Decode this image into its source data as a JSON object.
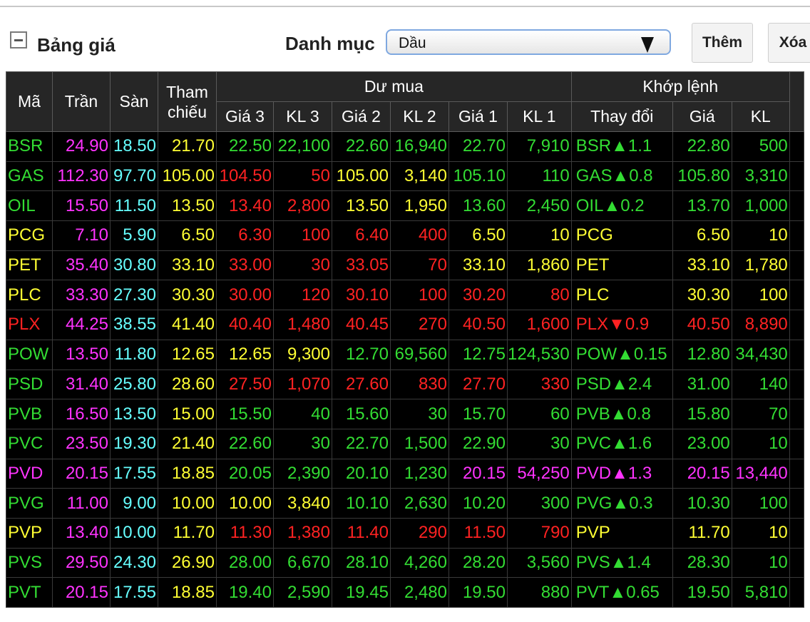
{
  "header": {
    "title": "Bảng giá",
    "category_label": "Danh mục",
    "category_value": "Dầu",
    "add_button": "Thêm",
    "delete_button": "Xóa"
  },
  "columns": {
    "ma": "Mã",
    "tran": "Trần",
    "san": "Sàn",
    "tham_chieu_1": "Tham",
    "tham_chieu_2": "chiếu",
    "du_mua": "Dư mua",
    "khop_lenh": "Khớp lệnh",
    "gia3": "Giá 3",
    "kl3": "KL 3",
    "gia2": "Giá 2",
    "kl2": "KL 2",
    "gia1": "Giá 1",
    "kl1": "KL 1",
    "thay_doi": "Thay đổi",
    "gia": "Giá",
    "kl": "KL"
  },
  "colors": {
    "ceiling": "#ff33ff",
    "floor": "#66ffff",
    "reference": "#ffff33",
    "up": "#33dd33",
    "down": "#ff2222",
    "flat": "#ffff33",
    "purple": "#ff33ff"
  },
  "rows": [
    {
      "sym": "BSR",
      "tran": "24.90",
      "san": "18.50",
      "ref": "21.70",
      "g3": "22.50",
      "k3": "22,100",
      "g2": "22.60",
      "k2": "16,940",
      "g1": "22.70",
      "k1": "7,910",
      "chg": "BSR▲1.1",
      "gia": "22.80",
      "kl": "500",
      "c": {
        "sym": "up",
        "g3": "up",
        "g2": "up",
        "g1": "up",
        "m": "up"
      }
    },
    {
      "sym": "GAS",
      "tran": "112.30",
      "san": "97.70",
      "ref": "105.00",
      "g3": "104.50",
      "k3": "50",
      "g2": "105.00",
      "k2": "3,140",
      "g1": "105.10",
      "k1": "110",
      "chg": "GAS▲0.8",
      "gia": "105.80",
      "kl": "3,310",
      "c": {
        "sym": "up",
        "g3": "down",
        "g2": "flat",
        "g1": "up",
        "m": "up"
      }
    },
    {
      "sym": "OIL",
      "tran": "15.50",
      "san": "11.50",
      "ref": "13.50",
      "g3": "13.40",
      "k3": "2,800",
      "g2": "13.50",
      "k2": "1,950",
      "g1": "13.60",
      "k1": "2,450",
      "chg": "OIL▲0.2",
      "gia": "13.70",
      "kl": "1,000",
      "c": {
        "sym": "up",
        "g3": "down",
        "g2": "flat",
        "g1": "up",
        "m": "up"
      }
    },
    {
      "sym": "PCG",
      "tran": "7.10",
      "san": "5.90",
      "ref": "6.50",
      "g3": "6.30",
      "k3": "100",
      "g2": "6.40",
      "k2": "400",
      "g1": "6.50",
      "k1": "10",
      "chg": "PCG",
      "gia": "6.50",
      "kl": "10",
      "c": {
        "sym": "flat",
        "g3": "down",
        "g2": "down",
        "g1": "flat",
        "m": "flat"
      }
    },
    {
      "sym": "PET",
      "tran": "35.40",
      "san": "30.80",
      "ref": "33.10",
      "g3": "33.00",
      "k3": "30",
      "g2": "33.05",
      "k2": "70",
      "g1": "33.10",
      "k1": "1,860",
      "chg": "PET",
      "gia": "33.10",
      "kl": "1,780",
      "c": {
        "sym": "flat",
        "g3": "down",
        "g2": "down",
        "g1": "flat",
        "m": "flat"
      }
    },
    {
      "sym": "PLC",
      "tran": "33.30",
      "san": "27.30",
      "ref": "30.30",
      "g3": "30.00",
      "k3": "120",
      "g2": "30.10",
      "k2": "100",
      "g1": "30.20",
      "k1": "80",
      "chg": "PLC",
      "gia": "30.30",
      "kl": "100",
      "c": {
        "sym": "flat",
        "g3": "down",
        "g2": "down",
        "g1": "down",
        "m": "flat"
      }
    },
    {
      "sym": "PLX",
      "tran": "44.25",
      "san": "38.55",
      "ref": "41.40",
      "g3": "40.40",
      "k3": "1,480",
      "g2": "40.45",
      "k2": "270",
      "g1": "40.50",
      "k1": "1,600",
      "chg": "PLX▼0.9",
      "gia": "40.50",
      "kl": "8,890",
      "c": {
        "sym": "down",
        "g3": "down",
        "g2": "down",
        "g1": "down",
        "m": "down"
      }
    },
    {
      "sym": "POW",
      "tran": "13.50",
      "san": "11.80",
      "ref": "12.65",
      "g3": "12.65",
      "k3": "9,300",
      "g2": "12.70",
      "k2": "69,560",
      "g1": "12.75",
      "k1": "124,530",
      "chg": "POW▲0.15",
      "gia": "12.80",
      "kl": "34,430",
      "c": {
        "sym": "up",
        "g3": "flat",
        "g2": "up",
        "g1": "up",
        "m": "up"
      }
    },
    {
      "sym": "PSD",
      "tran": "31.40",
      "san": "25.80",
      "ref": "28.60",
      "g3": "27.50",
      "k3": "1,070",
      "g2": "27.60",
      "k2": "830",
      "g1": "27.70",
      "k1": "330",
      "chg": "PSD▲2.4",
      "gia": "31.00",
      "kl": "140",
      "c": {
        "sym": "up",
        "g3": "down",
        "g2": "down",
        "g1": "down",
        "m": "up"
      }
    },
    {
      "sym": "PVB",
      "tran": "16.50",
      "san": "13.50",
      "ref": "15.00",
      "g3": "15.50",
      "k3": "40",
      "g2": "15.60",
      "k2": "30",
      "g1": "15.70",
      "k1": "60",
      "chg": "PVB▲0.8",
      "gia": "15.80",
      "kl": "70",
      "c": {
        "sym": "up",
        "g3": "up",
        "g2": "up",
        "g1": "up",
        "m": "up"
      }
    },
    {
      "sym": "PVC",
      "tran": "23.50",
      "san": "19.30",
      "ref": "21.40",
      "g3": "22.60",
      "k3": "30",
      "g2": "22.70",
      "k2": "1,500",
      "g1": "22.90",
      "k1": "30",
      "chg": "PVC▲1.6",
      "gia": "23.00",
      "kl": "10",
      "c": {
        "sym": "up",
        "g3": "up",
        "g2": "up",
        "g1": "up",
        "m": "up"
      }
    },
    {
      "sym": "PVD",
      "tran": "20.15",
      "san": "17.55",
      "ref": "18.85",
      "g3": "20.05",
      "k3": "2,390",
      "g2": "20.10",
      "k2": "1,230",
      "g1": "20.15",
      "k1": "54,250",
      "chg": "PVD▲1.3",
      "gia": "20.15",
      "kl": "13,440",
      "c": {
        "sym": "purple",
        "g3": "up",
        "g2": "up",
        "g1": "purple",
        "m": "purple"
      }
    },
    {
      "sym": "PVG",
      "tran": "11.00",
      "san": "9.00",
      "ref": "10.00",
      "g3": "10.00",
      "k3": "3,840",
      "g2": "10.10",
      "k2": "2,630",
      "g1": "10.20",
      "k1": "300",
      "chg": "PVG▲0.3",
      "gia": "10.30",
      "kl": "100",
      "c": {
        "sym": "up",
        "g3": "flat",
        "g2": "up",
        "g1": "up",
        "m": "up"
      }
    },
    {
      "sym": "PVP",
      "tran": "13.40",
      "san": "10.00",
      "ref": "11.70",
      "g3": "11.30",
      "k3": "1,380",
      "g2": "11.40",
      "k2": "290",
      "g1": "11.50",
      "k1": "790",
      "chg": "PVP",
      "gia": "11.70",
      "kl": "10",
      "c": {
        "sym": "flat",
        "g3": "down",
        "g2": "down",
        "g1": "down",
        "m": "flat"
      }
    },
    {
      "sym": "PVS",
      "tran": "29.50",
      "san": "24.30",
      "ref": "26.90",
      "g3": "28.00",
      "k3": "6,670",
      "g2": "28.10",
      "k2": "4,260",
      "g1": "28.20",
      "k1": "3,560",
      "chg": "PVS▲1.4",
      "gia": "28.30",
      "kl": "10",
      "c": {
        "sym": "up",
        "g3": "up",
        "g2": "up",
        "g1": "up",
        "m": "up"
      }
    },
    {
      "sym": "PVT",
      "tran": "20.15",
      "san": "17.55",
      "ref": "18.85",
      "g3": "19.40",
      "k3": "2,590",
      "g2": "19.45",
      "k2": "2,480",
      "g1": "19.50",
      "k1": "880",
      "chg": "PVT▲0.65",
      "gia": "19.50",
      "kl": "5,810",
      "c": {
        "sym": "up",
        "g3": "up",
        "g2": "up",
        "g1": "up",
        "m": "up"
      }
    }
  ]
}
